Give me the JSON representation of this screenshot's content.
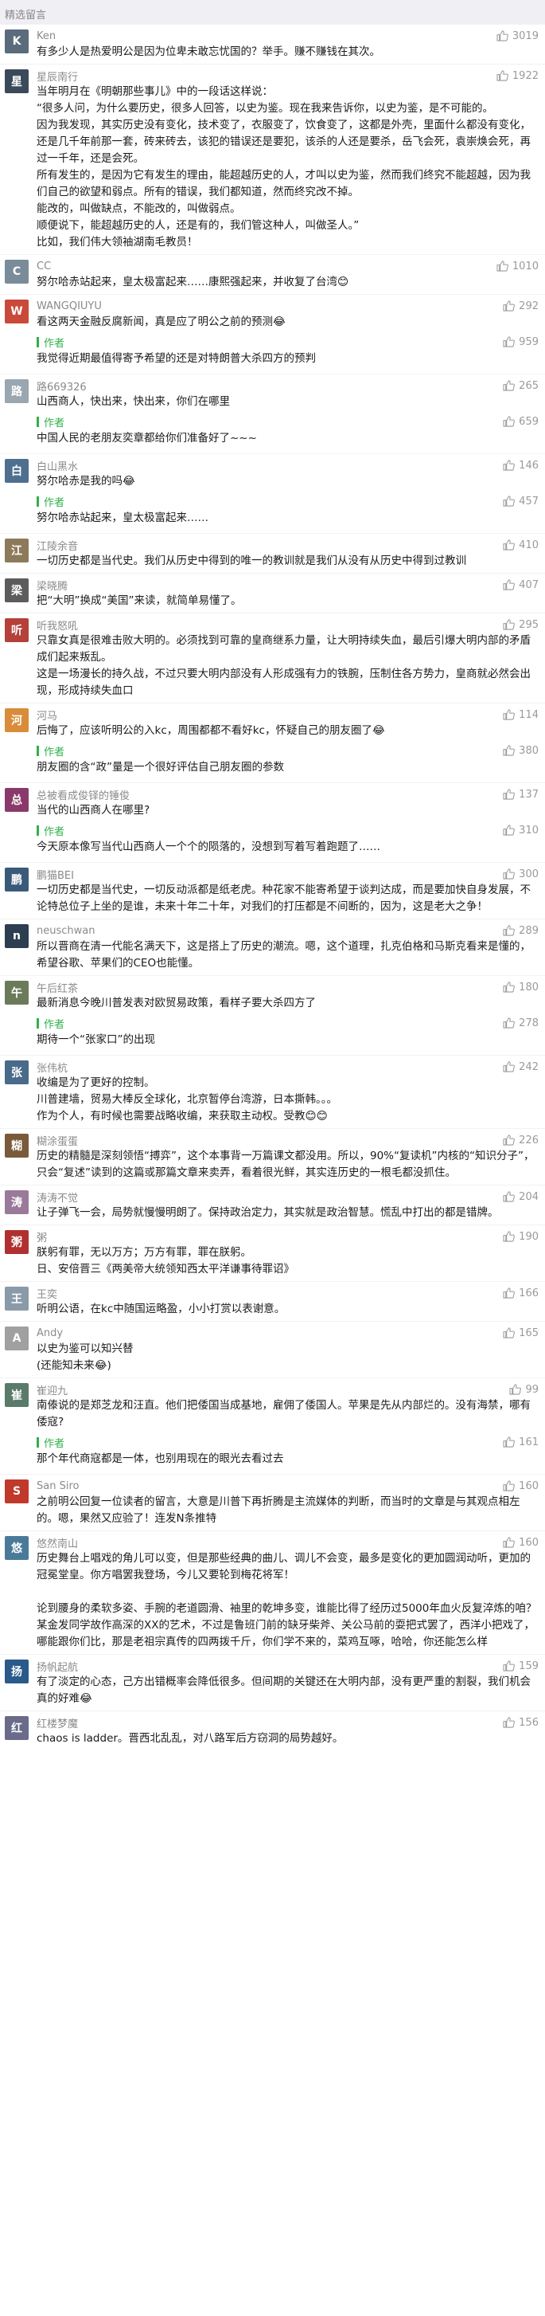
{
  "header": {
    "title": "精选留言"
  },
  "comments": [
    {
      "name": "Ken",
      "likes": "3019",
      "avatar_color": "#5a6b7c",
      "avatar_text": "K",
      "text": "有多少人是热爱明公是因为位卑未敢忘忧国的？举手。赚不赚钱在其次。"
    },
    {
      "name": "星辰南行",
      "likes": "1922",
      "avatar_color": "#3b4a5a",
      "avatar_text": "星",
      "text": "当年明月在《明朝那些事儿》中的一段话这样说：\n“很多人问，为什么要历史，很多人回答，以史为鉴。现在我来告诉你，以史为鉴，是不可能的。\n因为我发现，其实历史没有变化，技术变了，衣服变了，饮食变了，这都是外壳，里面什么都没有变化，还是几千年前那一套，砖来砖去，该犯的错误还是要犯，该杀的人还是要杀，岳飞会死，袁崇焕会死，再过一千年，还是会死。\n所有发生的，是因为它有发生的理由，能超越历史的人，才叫以史为鉴，然而我们终究不能超越，因为我们自己的欲望和弱点。所有的错误，我们都知道，然而终究改不掉。\n能改的，叫做缺点，不能改的，叫做弱点。\n顺便说下，能超越历史的人，还是有的，我们管这种人，叫做圣人。”\n比如，我们伟大领袖湖南毛教员！"
    },
    {
      "name": "CC",
      "likes": "1010",
      "avatar_color": "#7a8c9a",
      "avatar_text": "C",
      "text": "努尔哈赤站起来，皇太极富起来……康熙强起来，并收复了台湾😊"
    },
    {
      "name": "WANGQIUYU",
      "likes": "292",
      "avatar_color": "#c94a3a",
      "avatar_text": "W",
      "text": "看这两天金融反腐新闻，真是应了明公之前的预测😂",
      "reply": {
        "author": "作者",
        "likes": "959",
        "text": "我觉得近期最值得寄予希望的还是对特朗普大杀四方的预判"
      }
    },
    {
      "name": "路669326",
      "likes": "265",
      "avatar_color": "#9aa6b0",
      "avatar_text": "路",
      "text": "山西商人，快出来，快出来，你们在哪里",
      "reply": {
        "author": "作者",
        "likes": "659",
        "text": "中国人民的老朋友奕章都给你们准备好了~~~"
      }
    },
    {
      "name": "白山黑水",
      "likes": "146",
      "avatar_color": "#4f6f8f",
      "avatar_text": "白",
      "text": "努尔哈赤是我的吗😂",
      "reply": {
        "author": "作者",
        "likes": "457",
        "text": "努尔哈赤站起来，皇太极富起来……"
      }
    },
    {
      "name": "江陵余音",
      "likes": "410",
      "avatar_color": "#8c7a5a",
      "avatar_text": "江",
      "text": "一切历史都是当代史。我们从历史中得到的唯一的教训就是我们从没有从历史中得到过教训"
    },
    {
      "name": "梁晓腾",
      "likes": "407",
      "avatar_color": "#5c5c5c",
      "avatar_text": "梁",
      "text": "把“大明”换成“美国”来读，就简单易懂了。"
    },
    {
      "name": "听我怒吼",
      "likes": "295",
      "avatar_color": "#b5413b",
      "avatar_text": "听",
      "text": "只靠女真是很难击败大明的。必须找到可靠的皇商继系力量，让大明持续失血，最后引爆大明内部的矛盾成们起来叛乱。\n这是一场漫长的持久战，不过只要大明内部没有人形成强有力的铁腕，压制住各方势力，皇商就必然会出现，形成持续失血口"
    },
    {
      "name": "河马",
      "likes": "114",
      "avatar_color": "#d98c3a",
      "avatar_text": "河",
      "text": "后悔了，应该听明公的入kc，周围都都不看好kc，怀疑自己的朋友圈了😂",
      "reply": {
        "author": "作者",
        "likes": "380",
        "text": "朋友圈的含“政”量是一个很好评估自己朋友圈的参数"
      }
    },
    {
      "name": "总被看成俊铎的锤俊",
      "likes": "137",
      "avatar_color": "#8a3a6a",
      "avatar_text": "总",
      "text": "当代的山西商人在哪里?",
      "reply": {
        "author": "作者",
        "likes": "310",
        "text": "今天原本像写当代山西商人一个个的陨落的，没想到写着写着跑题了……"
      }
    },
    {
      "name": "鹏猫BEI",
      "likes": "300",
      "avatar_color": "#3a5a7a",
      "avatar_text": "鹏",
      "text": "一切历史都是当代史，一切反动派都是纸老虎。种花家不能寄希望于谈判达成，而是要加快自身发展，不论特总位子上坐的是谁，未来十年二十年，对我们的打压都是不间断的，因为，这是老大之争！"
    },
    {
      "name": "neuschwan",
      "likes": "289",
      "avatar_color": "#2c3e50",
      "avatar_text": "n",
      "text": "所以晋商在清一代能名满天下，这是搭上了历史的潮流。嗯，这个道理，扎克伯格和马斯克看来是懂的，希望谷歌、苹果们的CEO也能懂。"
    },
    {
      "name": "午后红茶",
      "likes": "180",
      "avatar_color": "#6b7b5a",
      "avatar_text": "午",
      "text": "最新消息今晚川普发表对欧贸易政策，看样子要大杀四方了",
      "reply": {
        "author": "作者",
        "likes": "278",
        "text": "期待一个“张家口”的出现"
      }
    },
    {
      "name": "张伟杭",
      "likes": "242",
      "avatar_color": "#4a6a8a",
      "avatar_text": "张",
      "text": "收编是为了更好的控制。\n川普建墙，贸易大棒反全球化，北京暂停台湾游，日本撕韩。。。\n作为个人，有时候也需要战略收编，来获取主动权。受教😊😊"
    },
    {
      "name": "糊涂蛋蛋",
      "likes": "226",
      "avatar_color": "#7a5a3a",
      "avatar_text": "糊",
      "text": "历史的精髓是深刻领悟“搏弈”，这个本事背一万篇课文都没用。所以，90%“复读机”内核的“知识分子”，只会“复述”读到的这篇或那篇文章来卖弄，看着很光鲜，其实连历史的一根毛都没抓住。"
    },
    {
      "name": "涛涛不觉",
      "likes": "204",
      "avatar_color": "#9a7a9a",
      "avatar_text": "涛",
      "text": "让子弹飞一会，局势就慢慢明朗了。保持政治定力，其实就是政治智慧。慌乱中打出的都是错牌。"
    },
    {
      "name": "粥",
      "likes": "190",
      "avatar_color": "#b03030",
      "avatar_text": "粥",
      "text": "朕躬有罪，无以万方；万方有罪，罪在朕躬。\n日、安倍晋三《两美帝大统领知西太平洋谦事待罪诏》"
    },
    {
      "name": "王奕",
      "likes": "166",
      "avatar_color": "#8a9aa8",
      "avatar_text": "王",
      "text": "听明公语，在kc中随国运略盈，小小打赏以表谢意。"
    },
    {
      "name": "Andy",
      "likes": "165",
      "avatar_color": "#a0a0a0",
      "avatar_text": "A",
      "text": "以史为鉴可以知兴替\n(还能知未来😂)"
    },
    {
      "name": "崔迎九",
      "likes": "99",
      "avatar_color": "#5a7a6a",
      "avatar_text": "崔",
      "text": "南傣说的是郑芝龙和汪直。他们把倭国当成基地，雇佣了倭国人。苹果是先从内部烂的。没有海禁，哪有倭寇?",
      "reply": {
        "author": "作者",
        "likes": "161",
        "text": "那个年代商寇都是一体，也别用现在的眼光去看过去"
      }
    },
    {
      "name": "San Siro",
      "likes": "160",
      "avatar_color": "#c0392b",
      "avatar_text": "S",
      "text": "之前明公回复一位读者的留言，大意是川普下再折腾是主流媒体的判断，而当时的文章是与其观点相左的。嗯，果然又应验了！连发N条推特"
    },
    {
      "name": "悠然南山",
      "likes": "160",
      "avatar_color": "#4a7a9a",
      "avatar_text": "悠",
      "text": "历史舞台上唱戏的角儿可以变，但是那些经典的曲儿、调儿不会变，最多是变化的更加圆润动听，更加的冠冕堂皇。你方唱罢我登场，今儿又要轮到梅花将军！\n\n论到腰身的柔软多姿、手腕的老道圆滑、袖里的乾坤多变，谁能比得了经历过5000年血火反复淬炼的咱？某金发同学故作高深的XX的艺术，不过是鲁班门前的缺牙柴斧、关公马前的耍把式罢了，西洋小把戏了，哪能跟你们比，那是老祖宗真传的四两拨千斤，你们学不来的，菜鸡互啄，哈哈，你还能怎么样"
    },
    {
      "name": "扬帆起航",
      "likes": "159",
      "avatar_color": "#2a5a8a",
      "avatar_text": "扬",
      "text": "有了淡定的心态，己方出错概率会降低很多。但间期的关键还在大明内部，没有更严重的割裂，我们机会真的好难😂"
    },
    {
      "name": "红楼梦魔",
      "likes": "156",
      "avatar_color": "#6a6a8a",
      "avatar_text": "红",
      "text": "chaos is ladder。晋西北乱乱，对八路军后方窃洞的局势越好。"
    }
  ]
}
